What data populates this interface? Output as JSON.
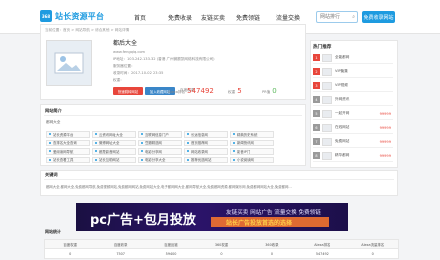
{
  "header": {
    "logo_badge": "368",
    "logo_text": "站长资源平台",
    "nav": [
      "首页",
      "免费收录",
      "友链买卖",
      "免费领链",
      "流量交换"
    ],
    "search_placeholder": "网站排行",
    "submit_label": "免费收录网站"
  },
  "breadcrumb": "当前位置：首页 > 网站导航 > 综合其他 > 网站详情",
  "site": {
    "name": "都后大全",
    "url": "www.fengqiq.com",
    "meta": [
      "IP地址：103.242.133.32 (香港 广州微额凯网络科技有限公司)",
      "服务器位置：",
      "收录时间：2017-10-02 23:35",
      "权重：",
      "ICP备案："
    ],
    "btn_visit": "快速跳转网站",
    "btn_fav": "加入收藏网站",
    "stats": {
      "baidu_label": "百度权重",
      "alexa_label": "Alexa排名",
      "alexa_value": "547492",
      "weight_label": "权重",
      "weight_value": "5",
      "pr_label": "PR值",
      "pr_value": "0"
    }
  },
  "sections": {
    "intro_title": "网站简介",
    "intro_label": "都网大全",
    "kw_title": "关键词",
    "keywords": "都网大全,都网大全,免费都网导航,免费视频网站,免费都网网站,免费网站大全,电子都网网大全,都网导航大全,免费都网资源,都网娱乐网,免费都网网站大全,免费都网...",
    "stats_title": "网站统计"
  },
  "tiles": [
    [
      "站长资源平台",
      "云资讯网址大全",
      "互联网信息门户",
      "长远信息网",
      "精典历史系统"
    ],
    [
      "查排名大全查询",
      "微博网址大全",
      "豆瓣精选网",
      "首页推荐网",
      "新闻快讯网"
    ],
    [
      "爱阅读网导航",
      "都是影音网站",
      "电影分享网",
      "网站收录网",
      "影音IP门"
    ],
    [
      "站长查看工具",
      "站长互助网站",
      "电影分享大全",
      "推荐优选网站",
      "小说阅读网"
    ]
  ],
  "banner": {
    "main": "pc广告+包月投放",
    "small": "友链买卖  网站广告  流量交换  免费领链",
    "gold": "站长广告投放首选的选择"
  },
  "table": {
    "headers": [
      "百度权重",
      "百度收录",
      "百度反链",
      "360权重",
      "360收录",
      "Alexa排名",
      "Alexa流量排名"
    ],
    "row": [
      "0",
      "7507",
      "59400",
      "0",
      "0",
      "547492",
      "0"
    ]
  },
  "sidebar": {
    "title": "热门推荐",
    "items": [
      {
        "no": "1",
        "name": "全能都网",
        "val": ""
      },
      {
        "no": "2",
        "name": "VIP聚集",
        "val": ""
      },
      {
        "no": "3",
        "name": "VIP视频",
        "val": ""
      },
      {
        "no": "4",
        "name": "外网资讯",
        "val": ""
      },
      {
        "no": "5",
        "name": "一起开网",
        "val": "99999"
      },
      {
        "no": "6",
        "name": "在线网站",
        "val": "99999"
      },
      {
        "no": "7",
        "name": "免费网站",
        "val": "99999"
      },
      {
        "no": "8",
        "name": "精华都网",
        "val": "99999"
      }
    ]
  },
  "colors": {
    "accent": "#1e9be0",
    "red": "#e8463b"
  }
}
